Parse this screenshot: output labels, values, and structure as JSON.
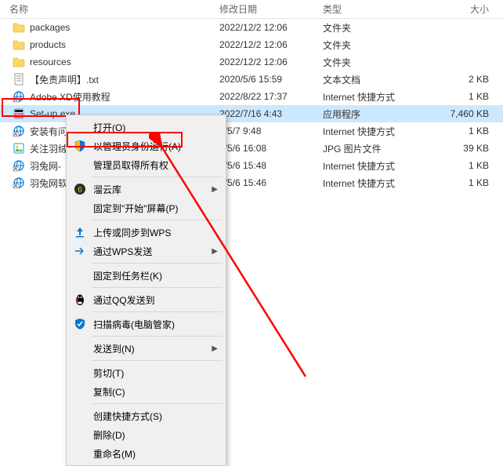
{
  "header": {
    "name": "名称",
    "date": "修改日期",
    "type": "类型",
    "size": "大小"
  },
  "files": [
    {
      "icon": "folder",
      "name": "packages",
      "date": "2022/12/2 12:06",
      "type": "文件夹",
      "size": ""
    },
    {
      "icon": "folder",
      "name": "products",
      "date": "2022/12/2 12:06",
      "type": "文件夹",
      "size": ""
    },
    {
      "icon": "folder",
      "name": "resources",
      "date": "2022/12/2 12:06",
      "type": "文件夹",
      "size": ""
    },
    {
      "icon": "txt",
      "name": "【免责声明】.txt",
      "date": "2020/5/6 15:59",
      "type": "文本文档",
      "size": "2 KB"
    },
    {
      "icon": "url",
      "name": "Adobe XD使用教程",
      "date": "2022/8/22 17:37",
      "type": "Internet 快捷方式",
      "size": "1 KB"
    },
    {
      "icon": "exe",
      "name": "Set-up.exe",
      "date": "2022/7/16 4:43",
      "type": "应用程序",
      "size": "7,460 KB",
      "selected": true
    },
    {
      "icon": "url",
      "name": "安装有问",
      "date": "0/5/7 9:48",
      "type": "Internet 快捷方式",
      "size": "1 KB"
    },
    {
      "icon": "jpg",
      "name": "关注羽绒",
      "date": "0/5/6 16:08",
      "type": "JPG 图片文件",
      "size": "39 KB"
    },
    {
      "icon": "url",
      "name": "羽兔网-",
      "date": "0/5/6 15:48",
      "type": "Internet 快捷方式",
      "size": "1 KB"
    },
    {
      "icon": "url",
      "name": "羽兔网软",
      "date": "0/5/6 15:46",
      "type": "Internet 快捷方式",
      "size": "1 KB"
    }
  ],
  "menu": {
    "open": "打开(O)",
    "runAsAdmin": "以管理员身份运行(A)",
    "adminOwnership": "管理员取得所有权",
    "liuYunKu": "溜云库",
    "pinToStart": "固定到\"开始\"屏幕(P)",
    "uploadWps": "上传或同步到WPS",
    "sendWps": "通过WPS发送",
    "pinTaskbar": "固定到任务栏(K)",
    "sendQQ": "通过QQ发送到",
    "scanVirus": "扫描病毒(电脑管家)",
    "sendTo": "发送到(N)",
    "cut": "剪切(T)",
    "copy": "复制(C)",
    "createShortcut": "创建快捷方式(S)",
    "delete": "删除(D)",
    "rename": "重命名(M)"
  }
}
